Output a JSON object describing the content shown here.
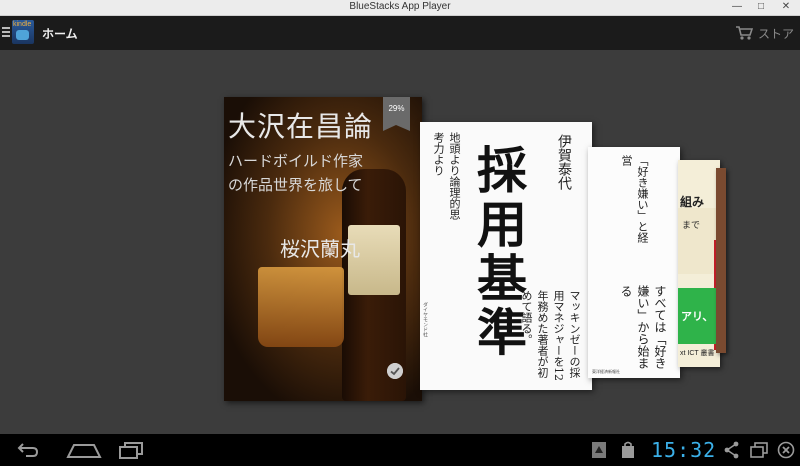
{
  "window": {
    "title": "BlueStacks App Player",
    "controls": {
      "minimize": "—",
      "maximize": "□",
      "close": "✕"
    }
  },
  "actionbar": {
    "menu_icon": "menu-icon",
    "logo_text": "kindle",
    "title": "ホーム",
    "store_label": "ストア",
    "store_icon": "cart-icon"
  },
  "books": [
    {
      "title": "大沢在昌論",
      "subtitle_line1": "ハードボイルド作家",
      "subtitle_line2": "の作品世界を旅して",
      "author": "桜沢蘭丸",
      "progress": "29%",
      "downloaded": true
    },
    {
      "title": "採用基準",
      "author": "伊賀泰代",
      "top_text": "地頭より論理的思考力より",
      "blurb": "マッキンゼーの採用マネジャーを12年務めた著者が初めて語る。",
      "publisher": "ダイヤモンド社"
    },
    {
      "top_text": "「好き嫌い」と経営",
      "blurb": "すべては「好き嫌い」から始まる",
      "publisher": "東洋経済新報社"
    },
    {
      "text1": "組み",
      "text2": "まで",
      "green_text": "アリ、",
      "bottom_text": "xt ICT 叢書"
    }
  ],
  "navbar": {
    "back_icon": "back-icon",
    "home_icon": "home-icon",
    "recents_icon": "recents-icon",
    "clock": "15:32",
    "clock_color": "#3bb0e8"
  },
  "colors": {
    "actionbar": "#1b1b1b",
    "background": "#3c3c3c",
    "navbar": "#000000",
    "accent": "#3bb0e8"
  }
}
